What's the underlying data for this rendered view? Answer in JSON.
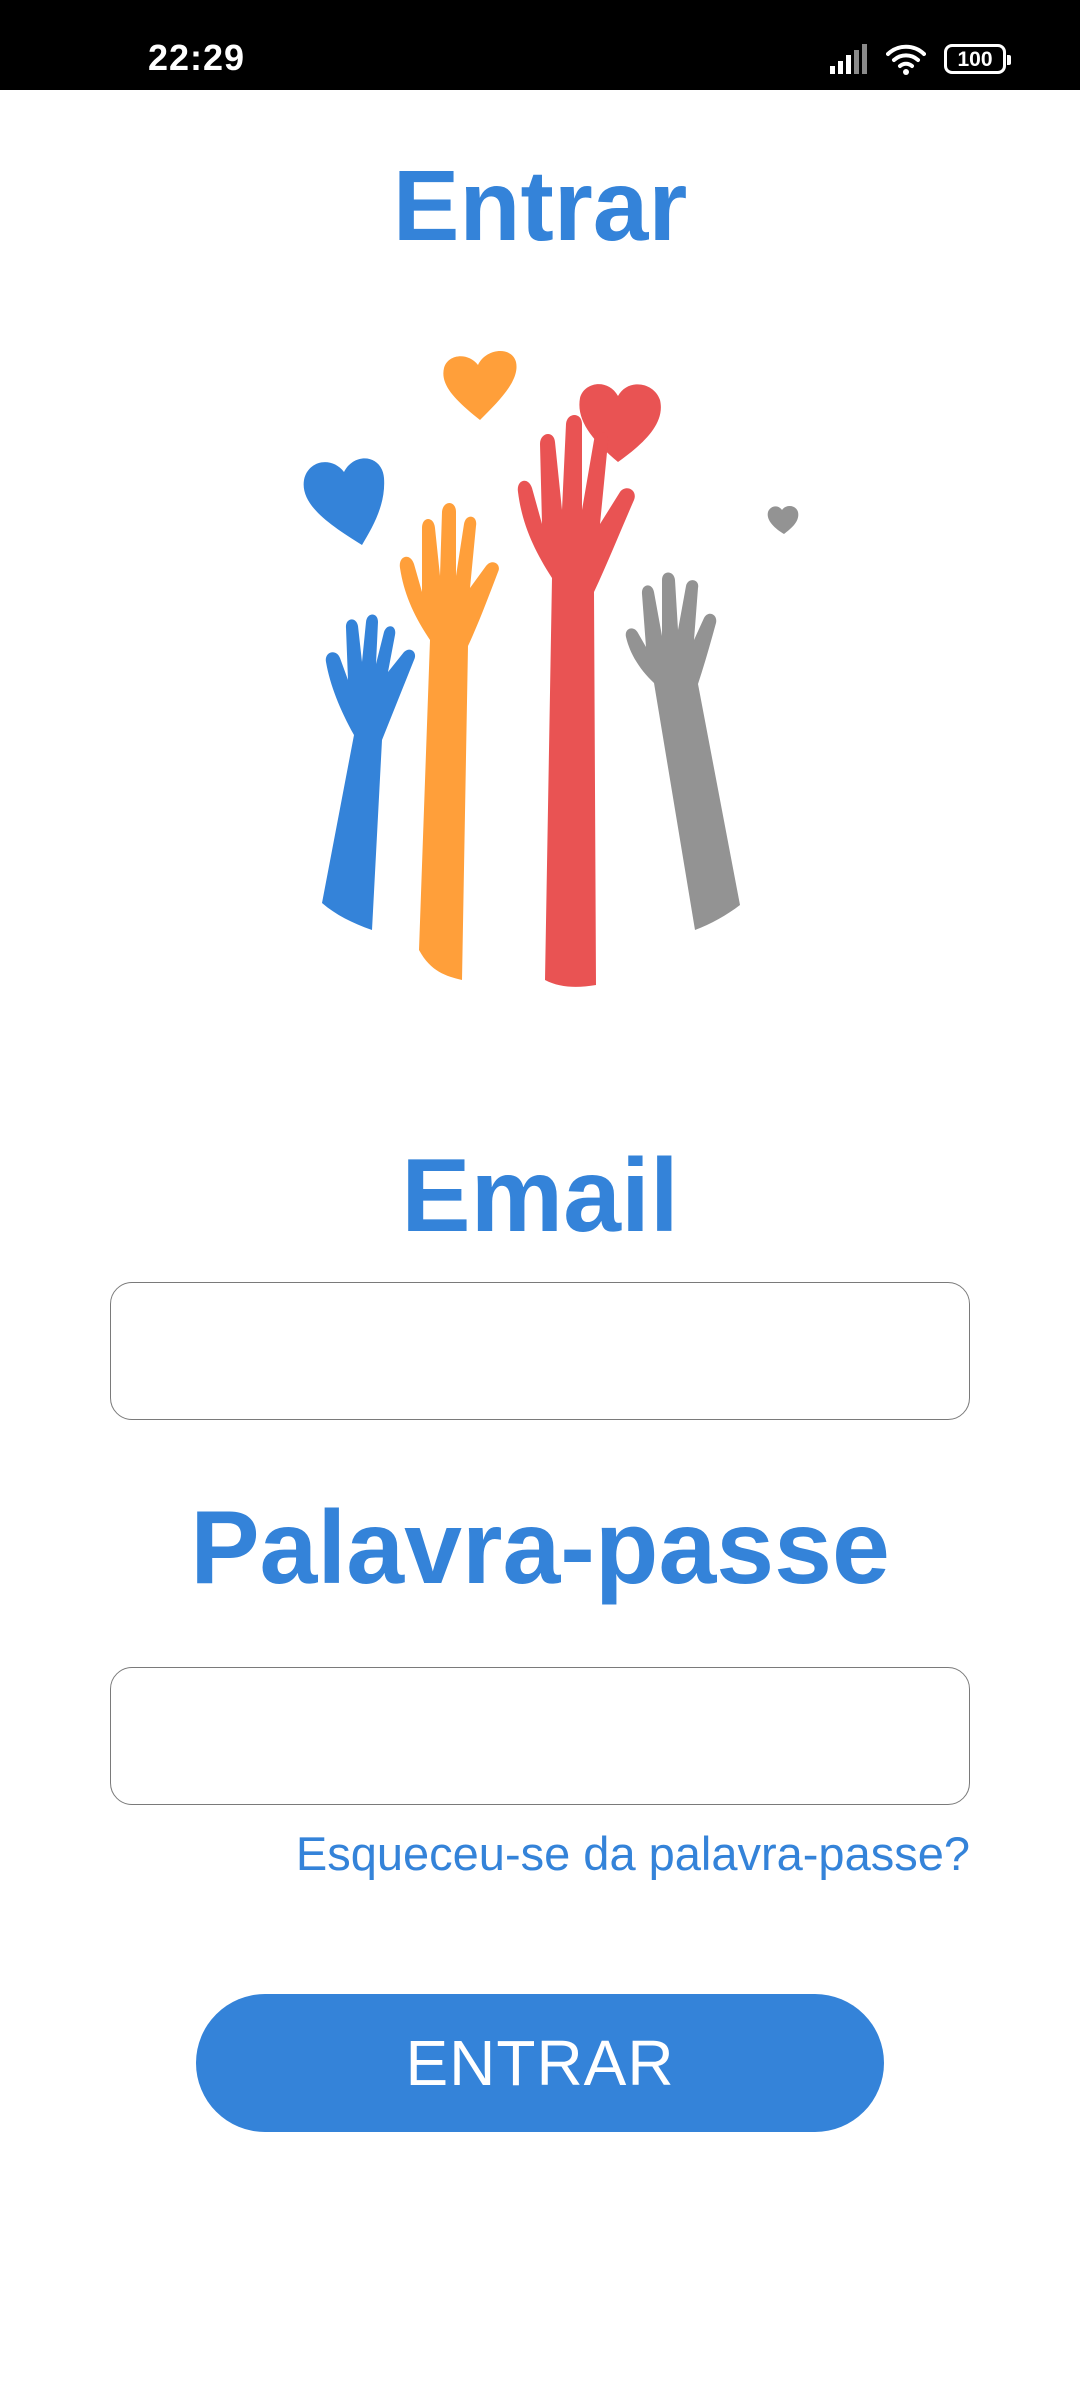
{
  "status_bar": {
    "time": "22:29",
    "battery": "100",
    "icons": [
      "signal-icon",
      "wifi-icon",
      "battery-icon"
    ]
  },
  "screen": {
    "title": "Entrar",
    "illustration": "raised-hands-hearts-illustration"
  },
  "form": {
    "email_label": "Email",
    "email_value": "",
    "password_label": "Palavra-passe",
    "password_value": "",
    "forgot_link": "Esqueceu-se da palavra-passe?",
    "submit_label": "ENTRAR"
  },
  "colors": {
    "primary": "#3483d9",
    "hand_blue": "#3483d9",
    "hand_orange": "#ff9f3a",
    "hand_red": "#e95353",
    "hand_gray": "#939393",
    "input_border": "#7a7a7a"
  }
}
